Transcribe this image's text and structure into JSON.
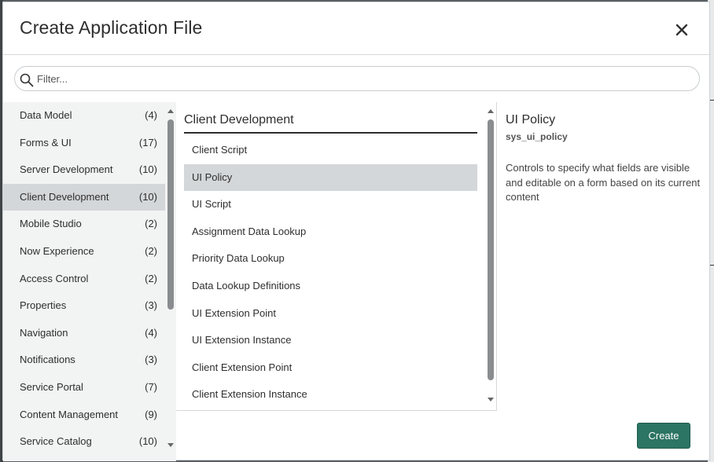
{
  "dialog": {
    "title": "Create Application File",
    "close_icon": "close-icon"
  },
  "filter": {
    "placeholder": "Filter...",
    "value": "",
    "icon": "search-icon"
  },
  "categories": [
    {
      "label": "Data Model",
      "count": "(4)",
      "selected": false
    },
    {
      "label": "Forms & UI",
      "count": "(17)",
      "selected": false
    },
    {
      "label": "Server Development",
      "count": "(10)",
      "selected": false
    },
    {
      "label": "Client Development",
      "count": "(10)",
      "selected": true
    },
    {
      "label": "Mobile Studio",
      "count": "(2)",
      "selected": false
    },
    {
      "label": "Now Experience",
      "count": "(2)",
      "selected": false
    },
    {
      "label": "Access Control",
      "count": "(2)",
      "selected": false
    },
    {
      "label": "Properties",
      "count": "(3)",
      "selected": false
    },
    {
      "label": "Navigation",
      "count": "(4)",
      "selected": false
    },
    {
      "label": "Notifications",
      "count": "(3)",
      "selected": false
    },
    {
      "label": "Service Portal",
      "count": "(7)",
      "selected": false
    },
    {
      "label": "Content Management",
      "count": "(9)",
      "selected": false
    },
    {
      "label": "Service Catalog",
      "count": "(10)",
      "selected": false
    }
  ],
  "file_types": {
    "heading": "Client Development",
    "items": [
      {
        "label": "Client Script",
        "selected": false
      },
      {
        "label": "UI Policy",
        "selected": true
      },
      {
        "label": "UI Script",
        "selected": false
      },
      {
        "label": "Assignment Data Lookup",
        "selected": false
      },
      {
        "label": "Priority Data Lookup",
        "selected": false
      },
      {
        "label": "Data Lookup Definitions",
        "selected": false
      },
      {
        "label": "UI Extension Point",
        "selected": false
      },
      {
        "label": "UI Extension Instance",
        "selected": false
      },
      {
        "label": "Client Extension Point",
        "selected": false
      },
      {
        "label": "Client Extension Instance",
        "selected": false
      }
    ]
  },
  "detail": {
    "title": "UI Policy",
    "table": "sys_ui_policy",
    "description": "Controls to specify what fields are visible and editable on a form based on its current content"
  },
  "footer": {
    "create_label": "Create"
  },
  "colors": {
    "primary_button": "#2c7463",
    "selected_row": "#d4d7d9",
    "category_panel_bg": "#f2f3f3"
  }
}
